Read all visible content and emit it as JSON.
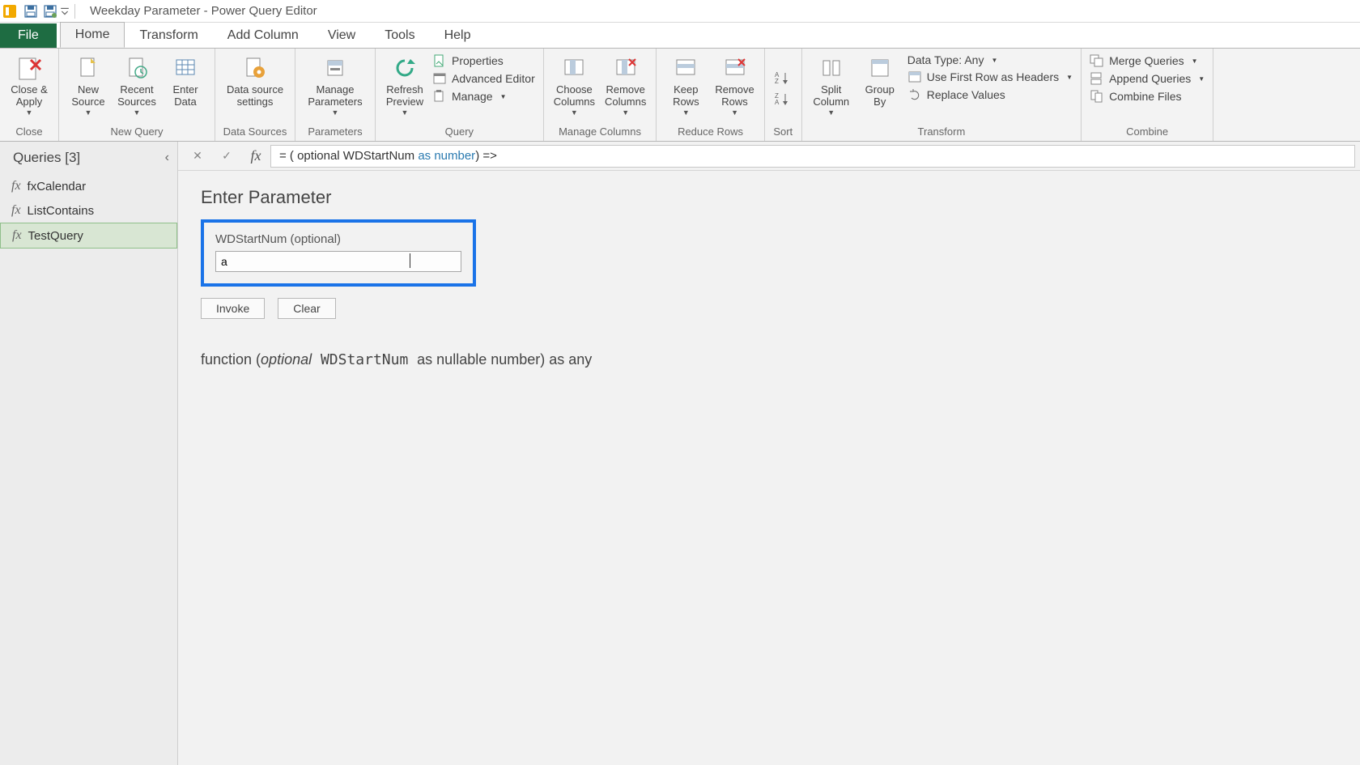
{
  "title": "Weekday Parameter - Power Query Editor",
  "tabs": {
    "file": "File",
    "home": "Home",
    "transform": "Transform",
    "addcol": "Add Column",
    "view": "View",
    "tools": "Tools",
    "help": "Help"
  },
  "ribbon": {
    "close": {
      "closeapply": "Close &\nApply",
      "group": "Close"
    },
    "new": {
      "newsource": "New\nSource",
      "recentsources": "Recent\nSources",
      "enterdata": "Enter\nData",
      "group": "New Query"
    },
    "ds": {
      "settings": "Data source\nsettings",
      "group": "Data Sources"
    },
    "params": {
      "manage": "Manage\nParameters",
      "group": "Parameters"
    },
    "query": {
      "refresh": "Refresh\nPreview",
      "properties": "Properties",
      "adveditor": "Advanced Editor",
      "manage": "Manage",
      "group": "Query"
    },
    "mcols": {
      "choose": "Choose\nColumns",
      "remove": "Remove\nColumns",
      "group": "Manage Columns"
    },
    "redrows": {
      "keep": "Keep\nRows",
      "remove": "Remove\nRows",
      "group": "Reduce Rows"
    },
    "sort": {
      "group": "Sort"
    },
    "transform": {
      "split": "Split\nColumn",
      "groupby": "Group\nBy",
      "datatype": "Data Type: Any",
      "firstrow": "Use First Row as Headers",
      "replace": "Replace Values",
      "group": "Transform"
    },
    "combine": {
      "merge": "Merge Queries",
      "append": "Append Queries",
      "combinefiles": "Combine Files",
      "group": "Combine"
    }
  },
  "sidebar": {
    "header": "Queries [3]",
    "items": [
      {
        "label": "fxCalendar"
      },
      {
        "label": "ListContains"
      },
      {
        "label": "TestQuery"
      }
    ]
  },
  "formula": {
    "prefix": "= ( optional WDStartNum ",
    "kw": "as number",
    "suffix": ") =>"
  },
  "param": {
    "heading": "Enter Parameter",
    "label": "WDStartNum (optional)",
    "value": "a",
    "invoke": "Invoke",
    "clear": "Clear"
  },
  "signature": {
    "p1": "function (",
    "opt": "optional",
    "name": " WDStartNum ",
    "rest": "as nullable number) as any"
  }
}
